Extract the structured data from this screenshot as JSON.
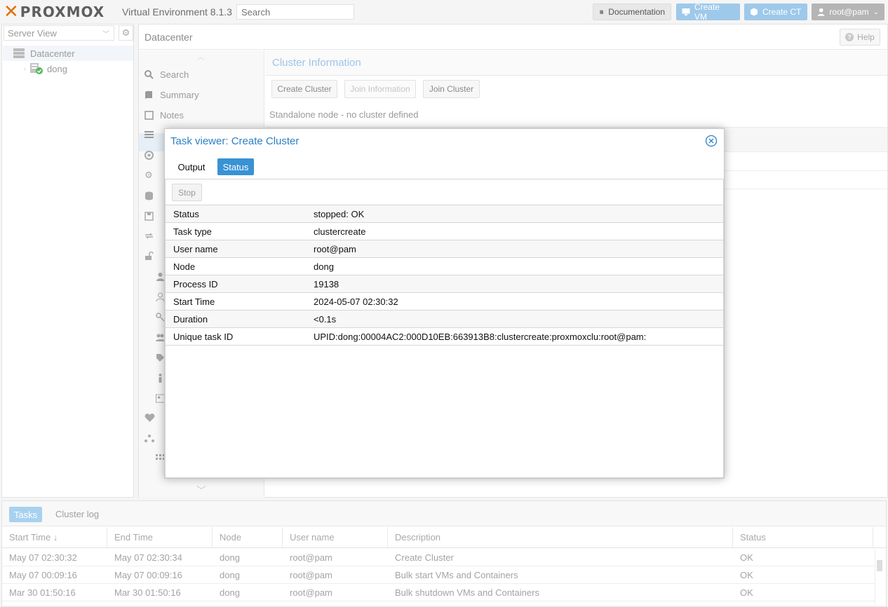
{
  "app": {
    "brand": "PROXMOX",
    "version": "Virtual Environment 8.1.3",
    "search_placeholder": "Search",
    "documentation_label": "Documentation",
    "create_vm_label": "Create VM",
    "create_ct_label": "Create CT",
    "user_label": "root@pam",
    "accent_color": "#3892d4",
    "logo_color": "#e57000"
  },
  "tree": {
    "view_label": "Server View",
    "items": [
      {
        "label": "Datacenter",
        "icon": "server-rack-icon"
      },
      {
        "label": "dong",
        "icon": "node-online-icon"
      }
    ]
  },
  "main": {
    "breadcrumb": "Datacenter",
    "help_label": "Help",
    "nav": [
      {
        "label": "Search",
        "icon": "search-icon"
      },
      {
        "label": "Summary",
        "icon": "book-icon"
      },
      {
        "label": "Notes",
        "icon": "notes-icon"
      }
    ],
    "cluster": {
      "title": "Cluster Information",
      "create_cluster_label": "Create Cluster",
      "join_information_label": "Join Information",
      "join_cluster_label": "Join Cluster",
      "standalone_text": "Standalone node - no cluster defined"
    }
  },
  "modal": {
    "title": "Task viewer: Create Cluster",
    "tabs": [
      "Output",
      "Status"
    ],
    "active_tab": "Status",
    "stop_label": "Stop",
    "rows": [
      {
        "key": "Status",
        "value": "stopped: OK"
      },
      {
        "key": "Task type",
        "value": "clustercreate"
      },
      {
        "key": "User name",
        "value": "root@pam"
      },
      {
        "key": "Node",
        "value": "dong"
      },
      {
        "key": "Process ID",
        "value": "19138"
      },
      {
        "key": "Start Time",
        "value": "2024-05-07 02:30:32"
      },
      {
        "key": "Duration",
        "value": "<0.1s"
      },
      {
        "key": "Unique task ID",
        "value": "UPID:dong:00004AC2:000D10EB:663913B8:clustercreate:proxmoxclu:root@pam:"
      }
    ]
  },
  "tasks": {
    "tabs": [
      "Tasks",
      "Cluster log"
    ],
    "columns": [
      "Start Time",
      "End Time",
      "Node",
      "User name",
      "Description",
      "Status"
    ],
    "sort_indicator": "↓",
    "rows": [
      [
        "May 07 02:30:32",
        "May 07 02:30:34",
        "dong",
        "root@pam",
        "Create Cluster",
        "OK"
      ],
      [
        "May 07 00:09:16",
        "May 07 00:09:16",
        "dong",
        "root@pam",
        "Bulk start VMs and Containers",
        "OK"
      ],
      [
        "Mar 30 01:50:16",
        "Mar 30 01:50:16",
        "dong",
        "root@pam",
        "Bulk shutdown VMs and Containers",
        "OK"
      ]
    ]
  }
}
